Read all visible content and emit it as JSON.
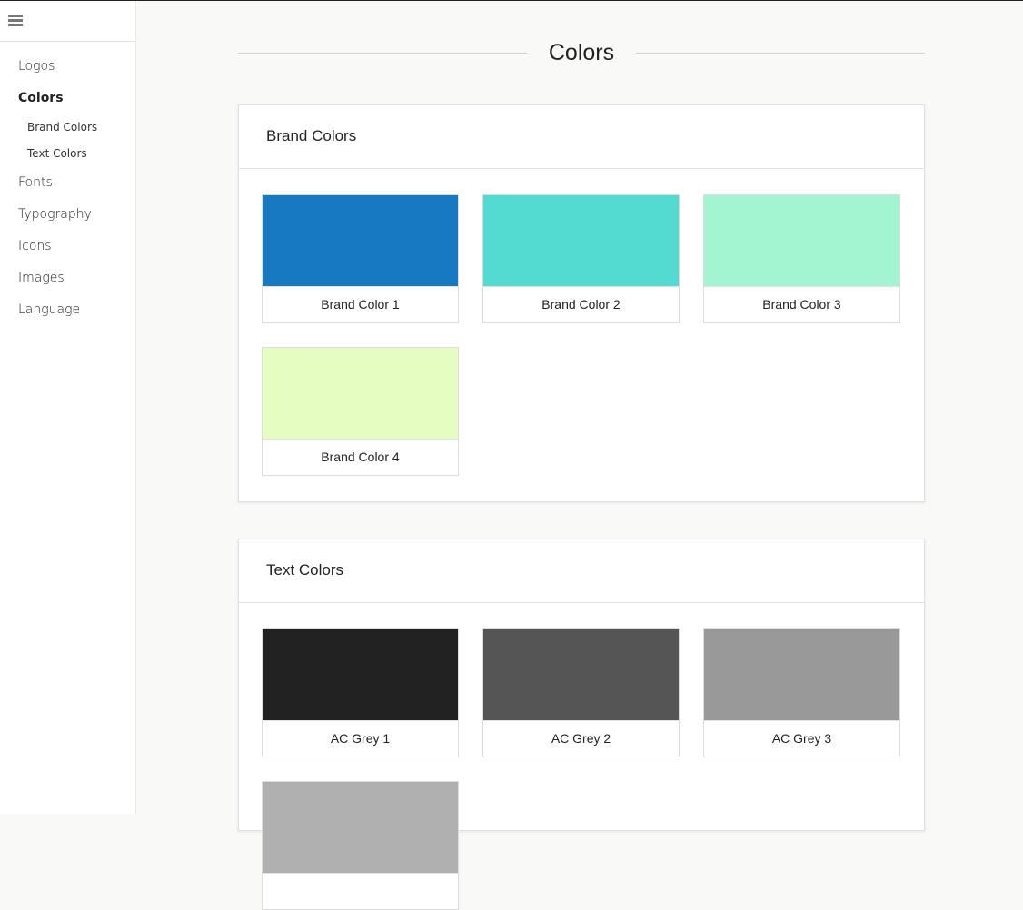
{
  "sidebar": {
    "menu_icon": "hamburger-menu-icon",
    "items": [
      {
        "label": "Logos"
      },
      {
        "label": "Colors",
        "active": true
      },
      {
        "label": "Brand Colors",
        "sub": true
      },
      {
        "label": "Text Colors",
        "sub": true
      },
      {
        "label": "Fonts"
      },
      {
        "label": "Typography"
      },
      {
        "label": "Icons"
      },
      {
        "label": "Images"
      },
      {
        "label": "Language"
      }
    ]
  },
  "main": {
    "title": "Colors",
    "sections": [
      {
        "title": "Brand Colors",
        "swatches": [
          {
            "label": "Brand Color 1",
            "color": "#1679c1"
          },
          {
            "label": "Brand Color 2",
            "color": "#54dbd1"
          },
          {
            "label": "Brand Color 3",
            "color": "#a2f5d0"
          },
          {
            "label": "Brand Color 4",
            "color": "#e6fdc1"
          }
        ]
      },
      {
        "title": "Text Colors",
        "swatches": [
          {
            "label": "AC Grey 1",
            "color": "#222222"
          },
          {
            "label": "AC Grey 2",
            "color": "#555555"
          },
          {
            "label": "AC Grey 3",
            "color": "#999999"
          },
          {
            "label": "",
            "color": "#b0b0b0"
          }
        ]
      }
    ]
  }
}
